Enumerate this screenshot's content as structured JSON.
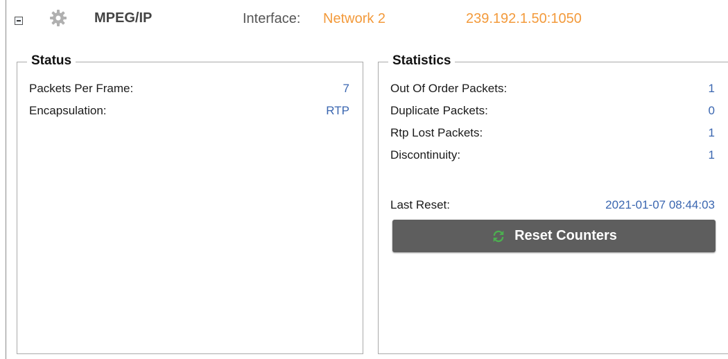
{
  "header": {
    "module_name": "MPEG/IP",
    "interface_label": "Interface:",
    "interface_value": "Network 2",
    "address": "239.192.1.50:1050",
    "icons": [
      "collapse-icon",
      "gear-icon"
    ]
  },
  "status": {
    "title": "Status",
    "rows": [
      {
        "label": "Packets Per Frame:",
        "value": "7"
      },
      {
        "label": "Encapsulation:",
        "value": "RTP"
      }
    ]
  },
  "statistics": {
    "title": "Statistics",
    "rows": [
      {
        "label": "Out Of Order Packets:",
        "value": "1"
      },
      {
        "label": "Duplicate Packets:",
        "value": "0"
      },
      {
        "label": "Rtp Lost Packets:",
        "value": "1"
      },
      {
        "label": "Discontinuity:",
        "value": "1"
      }
    ],
    "last_reset_label": "Last Reset:",
    "last_reset_value": "2021-01-07 08:44:03",
    "reset_button_label": "Reset Counters",
    "reset_icon": "refresh-icon"
  },
  "colors": {
    "accent_orange": "#f39a3b",
    "value_blue": "#3a66b0",
    "button_bg": "#5e5e5e",
    "refresh_green": "#4caf50"
  }
}
